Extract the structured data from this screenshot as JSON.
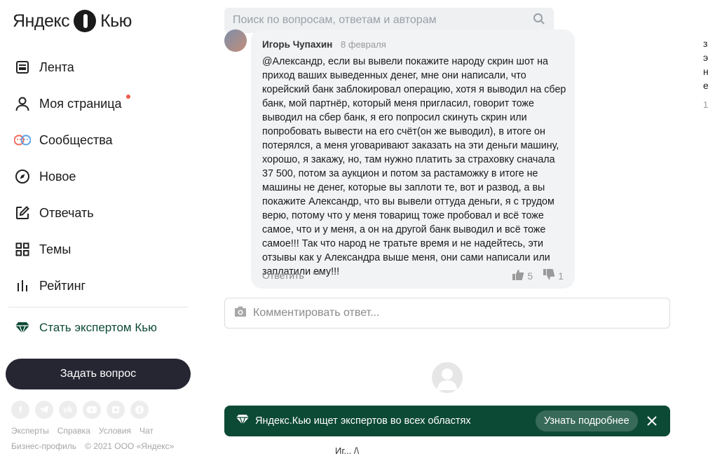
{
  "brand": {
    "name_left": "Яндекс",
    "name_right": "Кью"
  },
  "nav": [
    {
      "label": "Лента",
      "icon": "feed-icon"
    },
    {
      "label": "Моя страница",
      "icon": "user-icon"
    },
    {
      "label": "Сообщества",
      "icon": "communities-icon"
    },
    {
      "label": "Новое",
      "icon": "compass-icon"
    },
    {
      "label": "Отвечать",
      "icon": "edit-icon"
    },
    {
      "label": "Темы",
      "icon": "grid-icon"
    },
    {
      "label": "Рейтинг",
      "icon": "rating-icon"
    }
  ],
  "expert_link": "Стать экспертом Кью",
  "ask_button": "Задать вопрос",
  "socials": [
    "f",
    "tg",
    "vk",
    "yt",
    "ok",
    "q"
  ],
  "footer": {
    "links": [
      "Эксперты",
      "Справка",
      "Условия",
      "Чат"
    ],
    "line2": [
      "Бизнес-профиль",
      "© 2021 ООО «Яндекс»"
    ]
  },
  "search": {
    "placeholder": "Поиск по вопросам, ответам и авторам"
  },
  "comment": {
    "author": "Игорь Чупахин",
    "date": "8 февраля",
    "text": "@Александр, если вы вывели покажите народу скрин шот на приход ваших выведенных денег, мне они написали, что корейский банк заблокировал операцию, хотя я выводил на сбер банк, мой партнёр, который меня пригласил, говорит тоже выводил на сбер банк, я его попросил скинуть скрин или попробовать вывести на его счёт(он же выводил), в итоге он потерялся, а меня уговаривают заказать на эти деньги машину, хорошо, я закажу, но, там нужно платить за страховку сначала 37 500, потом за аукцион и потом за растаможку в итоге не машины не денег, которые вы заплоти те, вот и развод, а вы покажите Александр, что вы вывели оттуда деньги, я с трудом верю, потому что у меня товарищ тоже пробовал и всё тоже самое, что и у меня, а он на другой банк выводил и всё тоже самое!!! Так что народ не тратьте время и не надейтесь, эти отзывы как у Александра выше меня, они сами написали или заплатили ему!!!",
    "reply_label": "Ответить",
    "more_label": "•••",
    "likes": "5",
    "dislikes": "1"
  },
  "comment_input": {
    "placeholder": "Комментировать ответ..."
  },
  "banner": {
    "text": "Яндекс.Кью ищет экспертов во всех областях",
    "button": "Узнать подробнее"
  },
  "bottom_fragment": "Иг... /\\",
  "right_column": {
    "text": "з э н е",
    "number": "1"
  },
  "colors": {
    "accent_green": "#0d4a35",
    "ask_button_bg": "#262633",
    "notification_dot": "#f05a4b"
  }
}
